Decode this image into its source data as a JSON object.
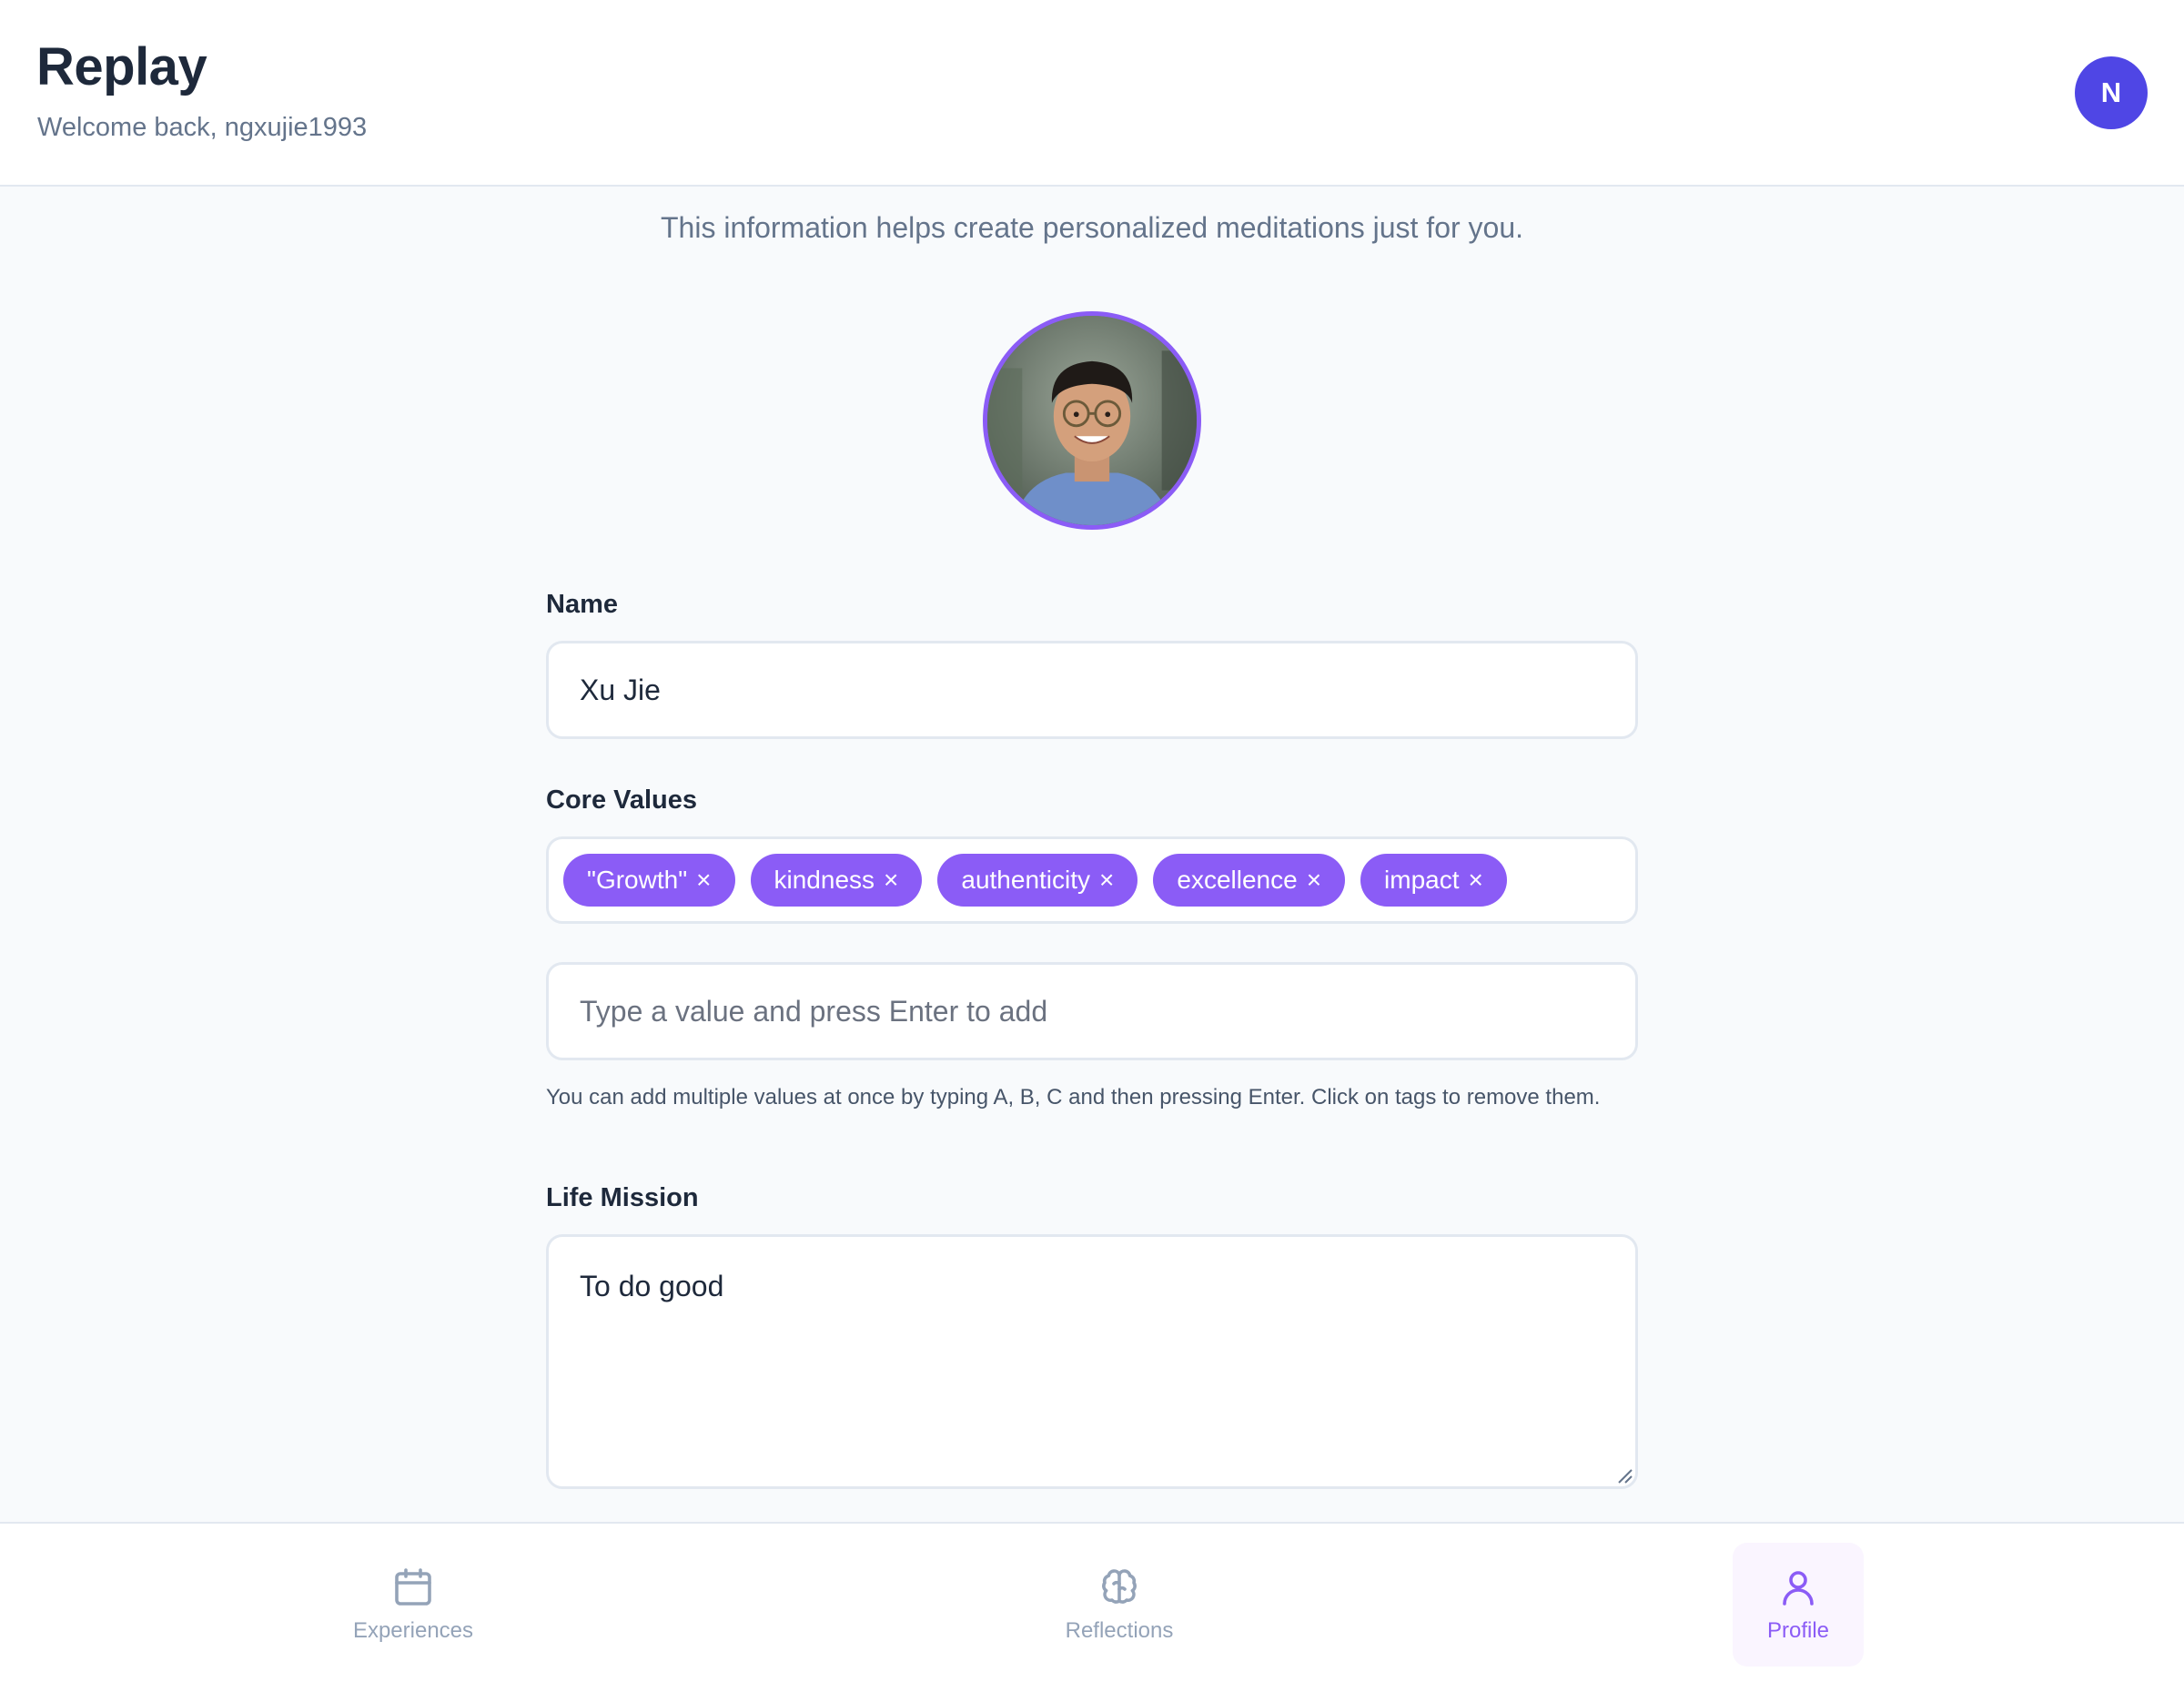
{
  "header": {
    "title": "Replay",
    "welcome": "Welcome back, ngxujie1993",
    "avatar_initial": "N"
  },
  "main": {
    "intro": "This information helps create personalized meditations just for you.",
    "name_field": {
      "label": "Name",
      "value": "Xu Jie"
    },
    "core_values": {
      "label": "Core Values",
      "tags": [
        "\"Growth\"",
        "kindness",
        "authenticity",
        "excellence",
        "impact"
      ],
      "remove_symbol": "×",
      "input_placeholder": "Type a value and press Enter to add",
      "helper": "You can add multiple values at once by typing A, B, C and then pressing Enter. Click on tags to remove them."
    },
    "life_mission": {
      "label": "Life Mission",
      "value": "To do good"
    }
  },
  "nav": {
    "items": [
      {
        "label": "Experiences",
        "icon": "calendar-icon"
      },
      {
        "label": "Reflections",
        "icon": "brain-icon"
      },
      {
        "label": "Profile",
        "icon": "user-icon"
      }
    ],
    "active": "Profile"
  },
  "colors": {
    "accent": "#8b5cf6",
    "avatar": "#4f46e5",
    "muted_text": "#64748b"
  }
}
